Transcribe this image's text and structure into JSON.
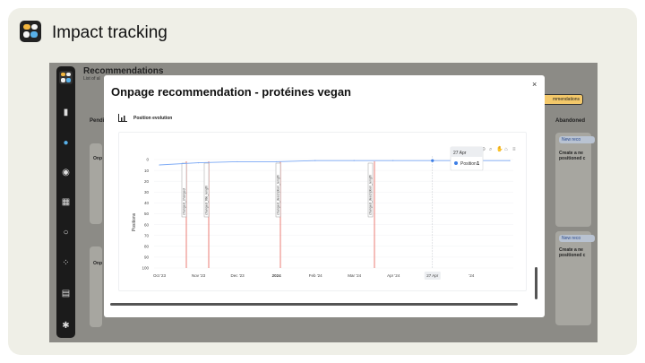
{
  "header": {
    "title": "Impact tracking"
  },
  "app": {
    "page_title": "Recommendations",
    "page_subtitle": "List of al",
    "tab_pending": "Pendi",
    "col_abandoned": "Abandoned",
    "action_button": "mmendations",
    "card_tag": "New reco",
    "card_title_1": "Onp",
    "card_title_2": "Onp",
    "card_right_1": "Create a ne positioned c",
    "card_right_2": "Create a ne positioned c"
  },
  "modal": {
    "title": "Onpage recommendation - protéines vegan",
    "close_label": "×",
    "section_label": "Position evolution"
  },
  "chart_data": {
    "type": "line",
    "ylabel": "Positions",
    "ylim": [
      0,
      100
    ],
    "y_inverted": true,
    "yticks": [
      0,
      10,
      20,
      30,
      40,
      50,
      60,
      70,
      80,
      90,
      100
    ],
    "xticks": [
      "Oct '23",
      "Nov '23",
      "Dec '23",
      "2024",
      "Feb '24",
      "Mar '24",
      "Apr '24",
      "27 Apr",
      "'24"
    ],
    "series": [
      {
        "name": "Position",
        "color": "#7aa8f5",
        "x": [
          "Oct '23",
          "mid Oct '23",
          "late Oct '23",
          "Nov '23",
          "Dec '23",
          "2024",
          "Feb '24",
          "Mar '24",
          "Apr '24",
          "27 Apr"
        ],
        "values": [
          5,
          3,
          2,
          2,
          1,
          1,
          1,
          1,
          1,
          1
        ]
      }
    ],
    "annotations": [
      "changed_changed",
      "changed_title_length",
      "changed_description_length",
      "changed_description_length"
    ],
    "tooltip": {
      "date": "27 Apr",
      "series": "Position",
      "value": "1"
    }
  }
}
